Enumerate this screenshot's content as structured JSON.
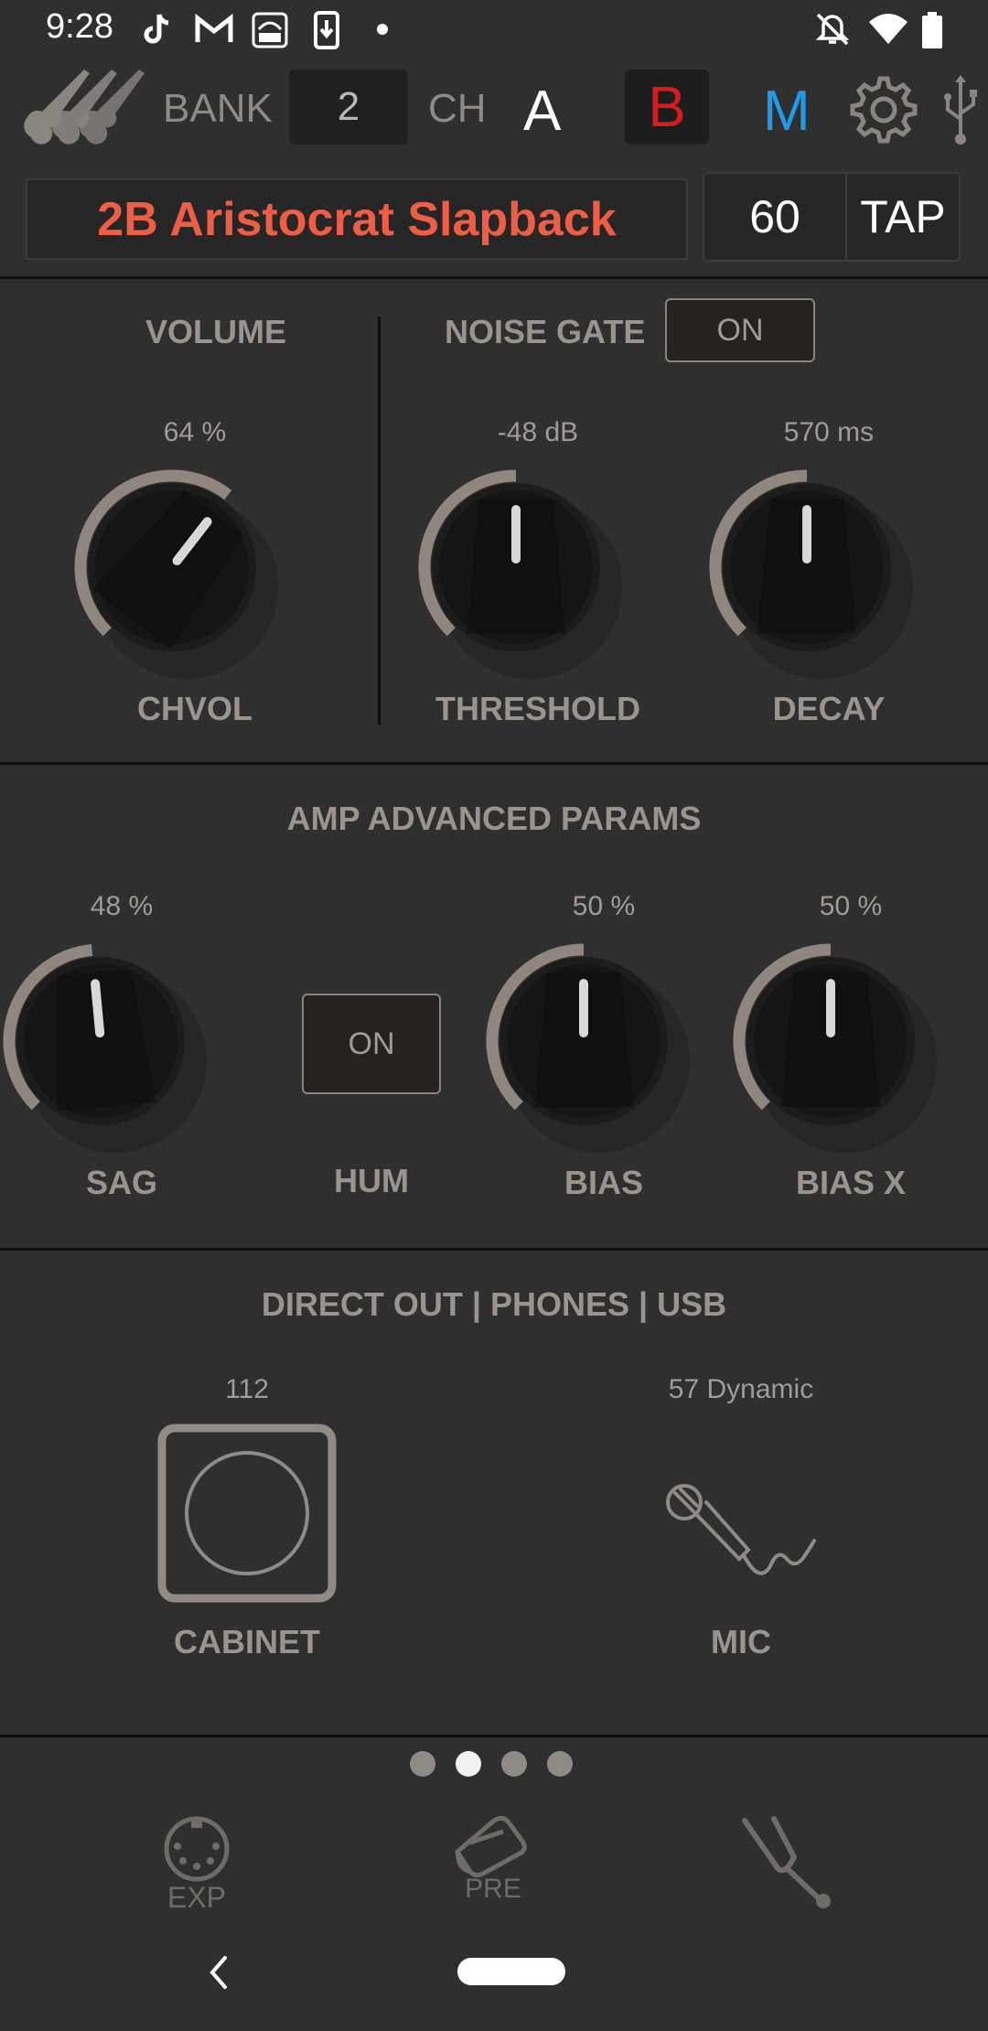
{
  "status": {
    "time": "9:28"
  },
  "header": {
    "bank_label": "BANK",
    "bank_value": "2",
    "ch_label": "CH",
    "channels": [
      "A",
      "B",
      "M"
    ],
    "preset_name": "2B Aristocrat Slapback",
    "tempo": "60",
    "tap_label": "TAP"
  },
  "volume": {
    "title": "VOLUME",
    "chvol": {
      "label": "CHVOL",
      "value": "64 %",
      "level": 0.64
    }
  },
  "noise_gate": {
    "title": "NOISE GATE",
    "toggle": "ON",
    "threshold": {
      "label": "THRESHOLD",
      "value": "-48 dB",
      "level": 0.5
    },
    "decay": {
      "label": "DECAY",
      "value": "570 ms",
      "level": 0.5
    }
  },
  "amp": {
    "title": "AMP ADVANCED PARAMS",
    "sag": {
      "label": "SAG",
      "value": "48 %",
      "level": 0.48
    },
    "hum": {
      "label": "HUM",
      "toggle": "ON"
    },
    "bias": {
      "label": "BIAS",
      "value": "50 %",
      "level": 0.5
    },
    "bias_x": {
      "label": "BIAS X",
      "value": "50 %",
      "level": 0.5
    }
  },
  "direct_out": {
    "title": "DIRECT OUT | PHONES | USB",
    "cabinet": {
      "label": "CABINET",
      "value": "112"
    },
    "mic": {
      "label": "MIC",
      "value": "57 Dynamic"
    }
  },
  "pager": {
    "count": 4,
    "active": 1
  },
  "bottom_nav": {
    "exp_label": "EXP",
    "pre_label": "PRE"
  },
  "colors": {
    "background": "#2f2f2f",
    "preset_text": "#ef5d45",
    "channel_b": "#d61c1c",
    "channel_m": "#1e9be8",
    "text_gray": "#9a948c"
  }
}
